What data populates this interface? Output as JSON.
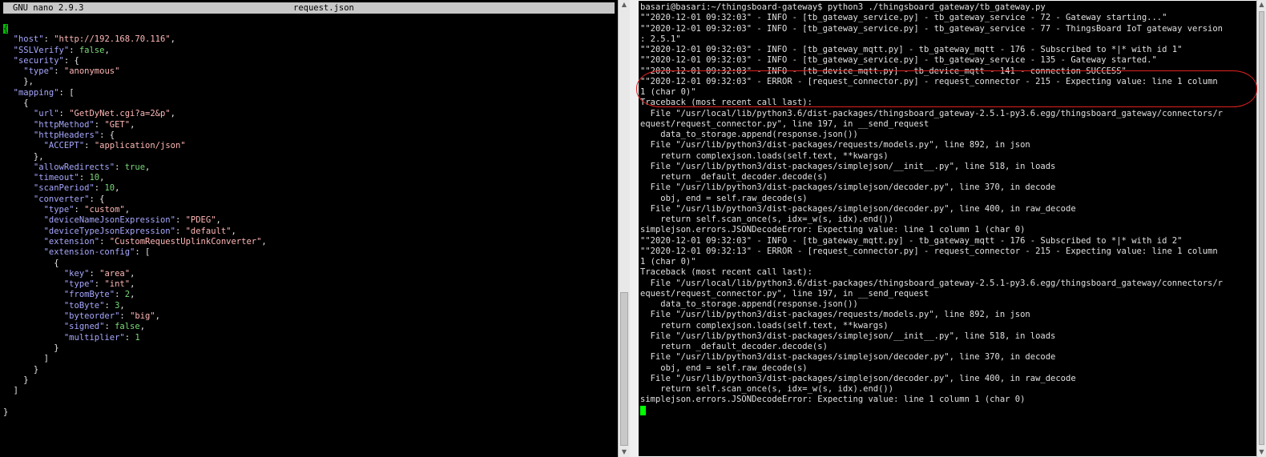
{
  "nano": {
    "app_name": "GNU nano 2.9.3",
    "file_name": "request.json",
    "lines": [
      [
        {
          "t": "{",
          "c": "brace-hl"
        }
      ],
      [
        {
          "t": "  \"host\"",
          "c": "k"
        },
        {
          "t": ": ",
          "c": "p"
        },
        {
          "t": "\"http://192.168.70.116\"",
          "c": "s"
        },
        {
          "t": ",",
          "c": "p"
        }
      ],
      [
        {
          "t": "  \"SSLVerify\"",
          "c": "k"
        },
        {
          "t": ": ",
          "c": "p"
        },
        {
          "t": "false",
          "c": "b"
        },
        {
          "t": ",",
          "c": "p"
        }
      ],
      [
        {
          "t": "  \"security\"",
          "c": "k"
        },
        {
          "t": ": {",
          "c": "p"
        }
      ],
      [
        {
          "t": "    \"type\"",
          "c": "k"
        },
        {
          "t": ": ",
          "c": "p"
        },
        {
          "t": "\"anonymous\"",
          "c": "s"
        }
      ],
      [
        {
          "t": "    },",
          "c": "p"
        }
      ],
      [
        {
          "t": "  \"mapping\"",
          "c": "k"
        },
        {
          "t": ": [",
          "c": "p"
        }
      ],
      [
        {
          "t": "    {",
          "c": "p"
        }
      ],
      [
        {
          "t": "      \"url\"",
          "c": "k"
        },
        {
          "t": ": ",
          "c": "p"
        },
        {
          "t": "\"GetDyNet.cgi?a=2&p\"",
          "c": "s"
        },
        {
          "t": ",",
          "c": "p"
        }
      ],
      [
        {
          "t": "      \"httpMethod\"",
          "c": "k"
        },
        {
          "t": ": ",
          "c": "p"
        },
        {
          "t": "\"GET\"",
          "c": "s"
        },
        {
          "t": ",",
          "c": "p"
        }
      ],
      [
        {
          "t": "      \"httpHeaders\"",
          "c": "k"
        },
        {
          "t": ": {",
          "c": "p"
        }
      ],
      [
        {
          "t": "        \"ACCEPT\"",
          "c": "k"
        },
        {
          "t": ": ",
          "c": "p"
        },
        {
          "t": "\"application/json\"",
          "c": "s"
        }
      ],
      [
        {
          "t": "      },",
          "c": "p"
        }
      ],
      [
        {
          "t": "      \"allowRedirects\"",
          "c": "k"
        },
        {
          "t": ": ",
          "c": "p"
        },
        {
          "t": "true",
          "c": "b"
        },
        {
          "t": ",",
          "c": "p"
        }
      ],
      [
        {
          "t": "      \"timeout\"",
          "c": "k"
        },
        {
          "t": ": ",
          "c": "p"
        },
        {
          "t": "10",
          "c": "n"
        },
        {
          "t": ",",
          "c": "p"
        }
      ],
      [
        {
          "t": "      \"scanPeriod\"",
          "c": "k"
        },
        {
          "t": ": ",
          "c": "p"
        },
        {
          "t": "10",
          "c": "n"
        },
        {
          "t": ",",
          "c": "p"
        }
      ],
      [
        {
          "t": "      \"converter\"",
          "c": "k"
        },
        {
          "t": ": {",
          "c": "p"
        }
      ],
      [
        {
          "t": "        \"type\"",
          "c": "k"
        },
        {
          "t": ": ",
          "c": "p"
        },
        {
          "t": "\"custom\"",
          "c": "s"
        },
        {
          "t": ",",
          "c": "p"
        }
      ],
      [
        {
          "t": "        \"deviceNameJsonExpression\"",
          "c": "k"
        },
        {
          "t": ": ",
          "c": "p"
        },
        {
          "t": "\"PDEG\"",
          "c": "s"
        },
        {
          "t": ",",
          "c": "p"
        }
      ],
      [
        {
          "t": "        \"deviceTypeJsonExpression\"",
          "c": "k"
        },
        {
          "t": ": ",
          "c": "p"
        },
        {
          "t": "\"default\"",
          "c": "s"
        },
        {
          "t": ",",
          "c": "p"
        }
      ],
      [
        {
          "t": "        \"extension\"",
          "c": "k"
        },
        {
          "t": ": ",
          "c": "p"
        },
        {
          "t": "\"CustomRequestUplinkConverter\"",
          "c": "s"
        },
        {
          "t": ",",
          "c": "p"
        }
      ],
      [
        {
          "t": "        \"extension-config\"",
          "c": "k"
        },
        {
          "t": ": [",
          "c": "p"
        }
      ],
      [
        {
          "t": "          {",
          "c": "p"
        }
      ],
      [
        {
          "t": "            \"key\"",
          "c": "k"
        },
        {
          "t": ": ",
          "c": "p"
        },
        {
          "t": "\"area\"",
          "c": "s"
        },
        {
          "t": ",",
          "c": "p"
        }
      ],
      [
        {
          "t": "            \"type\"",
          "c": "k"
        },
        {
          "t": ": ",
          "c": "p"
        },
        {
          "t": "\"int\"",
          "c": "s"
        },
        {
          "t": ",",
          "c": "p"
        }
      ],
      [
        {
          "t": "            \"fromByte\"",
          "c": "k"
        },
        {
          "t": ": ",
          "c": "p"
        },
        {
          "t": "2",
          "c": "n"
        },
        {
          "t": ",",
          "c": "p"
        }
      ],
      [
        {
          "t": "            \"toByte\"",
          "c": "k"
        },
        {
          "t": ": ",
          "c": "p"
        },
        {
          "t": "3",
          "c": "n"
        },
        {
          "t": ",",
          "c": "p"
        }
      ],
      [
        {
          "t": "            \"byteorder\"",
          "c": "k"
        },
        {
          "t": ": ",
          "c": "p"
        },
        {
          "t": "\"big\"",
          "c": "s"
        },
        {
          "t": ",",
          "c": "p"
        }
      ],
      [
        {
          "t": "            \"signed\"",
          "c": "k"
        },
        {
          "t": ": ",
          "c": "p"
        },
        {
          "t": "false",
          "c": "b"
        },
        {
          "t": ",",
          "c": "p"
        }
      ],
      [
        {
          "t": "            \"multiplier\"",
          "c": "k"
        },
        {
          "t": ": ",
          "c": "p"
        },
        {
          "t": "1",
          "c": "n"
        }
      ],
      [
        {
          "t": "          }",
          "c": "p"
        }
      ],
      [
        {
          "t": "        ]",
          "c": "p"
        }
      ],
      [
        {
          "t": "      }",
          "c": "p"
        }
      ],
      [
        {
          "t": "    }",
          "c": "p"
        }
      ],
      [
        {
          "t": "  ]",
          "c": "p"
        }
      ],
      [
        {
          "t": "",
          "c": "p"
        }
      ],
      [
        {
          "t": "}",
          "c": "p"
        }
      ]
    ]
  },
  "terminal": {
    "lines": [
      "basari@basari:~/thingsboard-gateway$ python3 ./thingsboard_gateway/tb_gateway.py",
      "\"\"2020-12-01 09:32:03\" - INFO - [tb_gateway_service.py] - tb_gateway_service - 72 - Gateway starting...\"",
      "\"\"2020-12-01 09:32:03\" - INFO - [tb_gateway_service.py] - tb_gateway_service - 77 - ThingsBoard IoT gateway version",
      ": 2.5.1\"",
      "\"\"2020-12-01 09:32:03\" - INFO - [tb_gateway_mqtt.py] - tb_gateway_mqtt - 176 - Subscribed to *|* with id 1\"",
      "\"\"2020-12-01 09:32:03\" - INFO - [tb_gateway_service.py] - tb_gateway_service - 135 - Gateway started.\"",
      "\"\"2020-12-01 09:32:03\" - INFO - [tb_device_mqtt.py] - tb_device_mqtt - 141 - connection SUCCESS\"",
      "\"\"2020-12-01 09:32:03\" - ERROR - [request_connector.py] - request_connector - 215 - Expecting value: line 1 column",
      "1 (char 0)\"",
      "Traceback (most recent call last):",
      "  File \"/usr/local/lib/python3.6/dist-packages/thingsboard_gateway-2.5.1-py3.6.egg/thingsboard_gateway/connectors/r",
      "equest/request_connector.py\", line 197, in __send_request",
      "    data_to_storage.append(response.json())",
      "  File \"/usr/lib/python3/dist-packages/requests/models.py\", line 892, in json",
      "    return complexjson.loads(self.text, **kwargs)",
      "  File \"/usr/lib/python3/dist-packages/simplejson/__init__.py\", line 518, in loads",
      "    return _default_decoder.decode(s)",
      "  File \"/usr/lib/python3/dist-packages/simplejson/decoder.py\", line 370, in decode",
      "    obj, end = self.raw_decode(s)",
      "  File \"/usr/lib/python3/dist-packages/simplejson/decoder.py\", line 400, in raw_decode",
      "    return self.scan_once(s, idx=_w(s, idx).end())",
      "simplejson.errors.JSONDecodeError: Expecting value: line 1 column 1 (char 0)",
      "\"\"2020-12-01 09:32:03\" - INFO - [tb_gateway_mqtt.py] - tb_gateway_mqtt - 176 - Subscribed to *|* with id 2\"",
      "\"\"2020-12-01 09:32:13\" - ERROR - [request_connector.py] - request_connector - 215 - Expecting value: line 1 column",
      "1 (char 0)\"",
      "Traceback (most recent call last):",
      "  File \"/usr/local/lib/python3.6/dist-packages/thingsboard_gateway-2.5.1-py3.6.egg/thingsboard_gateway/connectors/r",
      "equest/request_connector.py\", line 197, in __send_request",
      "    data_to_storage.append(response.json())",
      "  File \"/usr/lib/python3/dist-packages/requests/models.py\", line 892, in json",
      "    return complexjson.loads(self.text, **kwargs)",
      "  File \"/usr/lib/python3/dist-packages/simplejson/__init__.py\", line 518, in loads",
      "    return _default_decoder.decode(s)",
      "  File \"/usr/lib/python3/dist-packages/simplejson/decoder.py\", line 370, in decode",
      "    obj, end = self.raw_decode(s)",
      "  File \"/usr/lib/python3/dist-packages/simplejson/decoder.py\", line 400, in raw_decode",
      "    return self.scan_once(s, idx=_w(s, idx).end())",
      "simplejson.errors.JSONDecodeError: Expecting value: line 1 column 1 (char 0)"
    ]
  },
  "colors": {
    "annotation": "#e02020",
    "cursor": "#00ff00"
  }
}
